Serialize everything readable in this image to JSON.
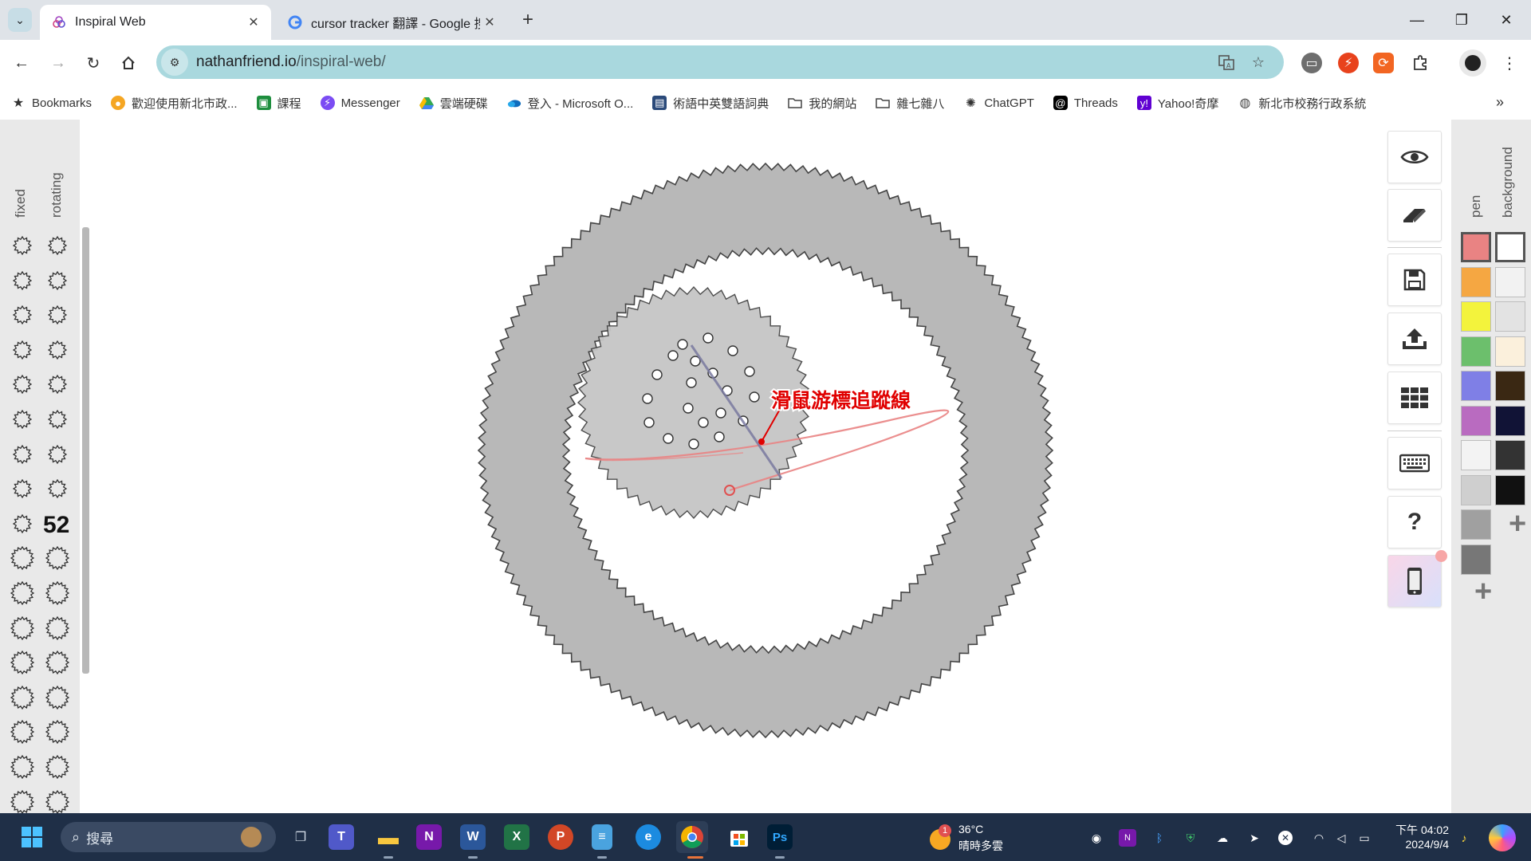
{
  "browser": {
    "tabs": [
      {
        "title": "Inspiral Web",
        "active": true
      },
      {
        "title": "cursor tracker 翻譯 - Google 搜",
        "active": false
      }
    ],
    "url_host": "nathanfriend.io",
    "url_path": "/inspiral-web/",
    "window_controls": {
      "minimize": "—",
      "restore": "❐",
      "close": "✕"
    }
  },
  "bookmarks": [
    {
      "label": "Bookmarks",
      "icon": "star-icon"
    },
    {
      "label": "歡迎使用新北市政...",
      "icon": "site-icon"
    },
    {
      "label": "課程",
      "icon": "classroom-icon"
    },
    {
      "label": "Messenger",
      "icon": "messenger-icon"
    },
    {
      "label": "雲端硬碟",
      "icon": "drive-icon"
    },
    {
      "label": "登入 - Microsoft O...",
      "icon": "onedrive-icon"
    },
    {
      "label": "術語中英雙語詞典",
      "icon": "dictionary-icon"
    },
    {
      "label": "我的網站",
      "icon": "folder-icon"
    },
    {
      "label": "雜七雜八",
      "icon": "folder-icon"
    },
    {
      "label": "ChatGPT",
      "icon": "chatgpt-icon"
    },
    {
      "label": "Threads",
      "icon": "threads-icon"
    },
    {
      "label": "Yahoo!奇摩",
      "icon": "yahoo-icon"
    },
    {
      "label": "新北市校務行政系統",
      "icon": "globe-icon"
    }
  ],
  "app": {
    "left_panel": {
      "fixed_label": "fixed",
      "rotating_label": "rotating",
      "selected_teeth_count": "52"
    },
    "annotation": "滑鼠游標追蹤線",
    "tools": [
      {
        "name": "visibility",
        "icon": "eye-icon"
      },
      {
        "name": "clear",
        "icon": "eraser-icon"
      },
      {
        "name": "save",
        "icon": "save-icon"
      },
      {
        "name": "upload",
        "icon": "upload-icon"
      },
      {
        "name": "gallery",
        "icon": "grid-icon"
      },
      {
        "name": "keyboard",
        "icon": "keyboard-icon"
      },
      {
        "name": "help",
        "icon": "question-icon"
      },
      {
        "name": "mobile",
        "icon": "phone-icon"
      }
    ],
    "palette": {
      "pen_label": "pen",
      "background_label": "background",
      "pen_colors": [
        "#e98383",
        "#f5a742",
        "#f3f33c",
        "#6cbf6c",
        "#7f7fe6",
        "#b96bc0",
        "#f3f3f3",
        "#cfcfcf",
        "#a0a0a0",
        "#777777"
      ],
      "background_colors": [
        "#ffffff",
        "#f2f2f2",
        "#e3e3e3",
        "#fbf0dc",
        "#3a2813",
        "#111336",
        "#333333",
        "#111111"
      ]
    }
  },
  "taskbar": {
    "search_placeholder": "搜尋",
    "weather_temp": "36°C",
    "weather_desc": "晴時多雲",
    "weather_badge": "1",
    "time": "下午 04:02",
    "date": "2024/9/4"
  }
}
